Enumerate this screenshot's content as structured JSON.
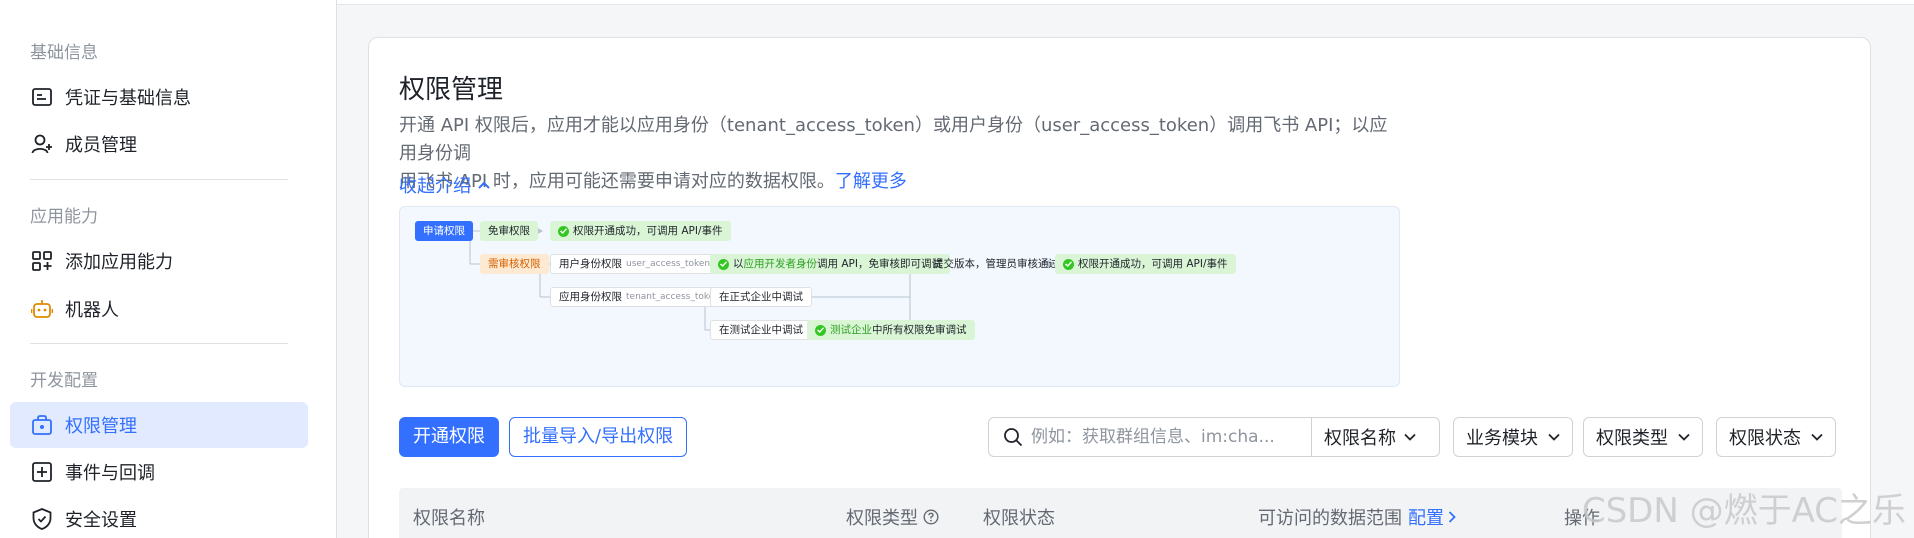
{
  "sidebar": {
    "groups": [
      {
        "title": "基础信息"
      },
      {
        "title": "应用能力"
      },
      {
        "title": "开发配置"
      }
    ],
    "items": [
      {
        "label": "凭证与基础信息",
        "icon": "credential-icon"
      },
      {
        "label": "成员管理",
        "icon": "user-add-icon"
      },
      {
        "label": "添加应用能力",
        "icon": "app-grid-icon"
      },
      {
        "label": "机器人",
        "icon": "robot-icon"
      },
      {
        "label": "权限管理",
        "icon": "permission-icon",
        "active": true
      },
      {
        "label": "事件与回调",
        "icon": "event-icon"
      },
      {
        "label": "安全设置",
        "icon": "shield-icon"
      }
    ]
  },
  "card": {
    "title": "权限管理",
    "desc_line1": "开通 API 权限后，应用才能以应用身份（tenant_access_token）或用户身份（user_access_token）调用飞书 API；以应用身份调",
    "desc_line2": "用飞书 API 时，应用可能还需要申请对应的数据权限。",
    "desc_link": "了解更多",
    "collapse_label": "收起介绍"
  },
  "flow": {
    "apply": "申请权限",
    "no_review": "免审权限",
    "success1": "权限开通成功，可调用 API/事件",
    "need_review": "需审核权限",
    "user_perm": "用户身份权限",
    "user_token": "user_access_token 调用",
    "dev_prefix": "以",
    "dev_green": "应用开发者身份",
    "dev_suffix": "调用 API，免审核即可调试",
    "submit": "提交版本，管理员审核通过",
    "success2": "权限开通成功，可调用 API/事件",
    "app_perm": "应用身份权限",
    "tenant_token": "tenant_access_token 调用",
    "formal": "在正式企业中调试",
    "test": "在测试企业中调试",
    "test_green": "测试企业",
    "test_suffix": "中所有权限免审调试"
  },
  "toolbar": {
    "enable_button": "开通权限",
    "batch_button": "批量导入/导出权限",
    "search_placeholder": "例如：获取群组信息、im:cha...",
    "search_field": "权限名称",
    "filters": [
      "业务模块",
      "权限类型",
      "权限状态"
    ]
  },
  "table": {
    "columns": {
      "name": "权限名称",
      "type": "权限类型",
      "status": "权限状态",
      "scope": "可访问的数据范围",
      "scope_link": "配置",
      "action": "操作"
    }
  },
  "watermark": "CSDN @燃于AC之乐",
  "colors": {
    "accent": "#3370ff",
    "active_bg": "#e1eaff"
  }
}
